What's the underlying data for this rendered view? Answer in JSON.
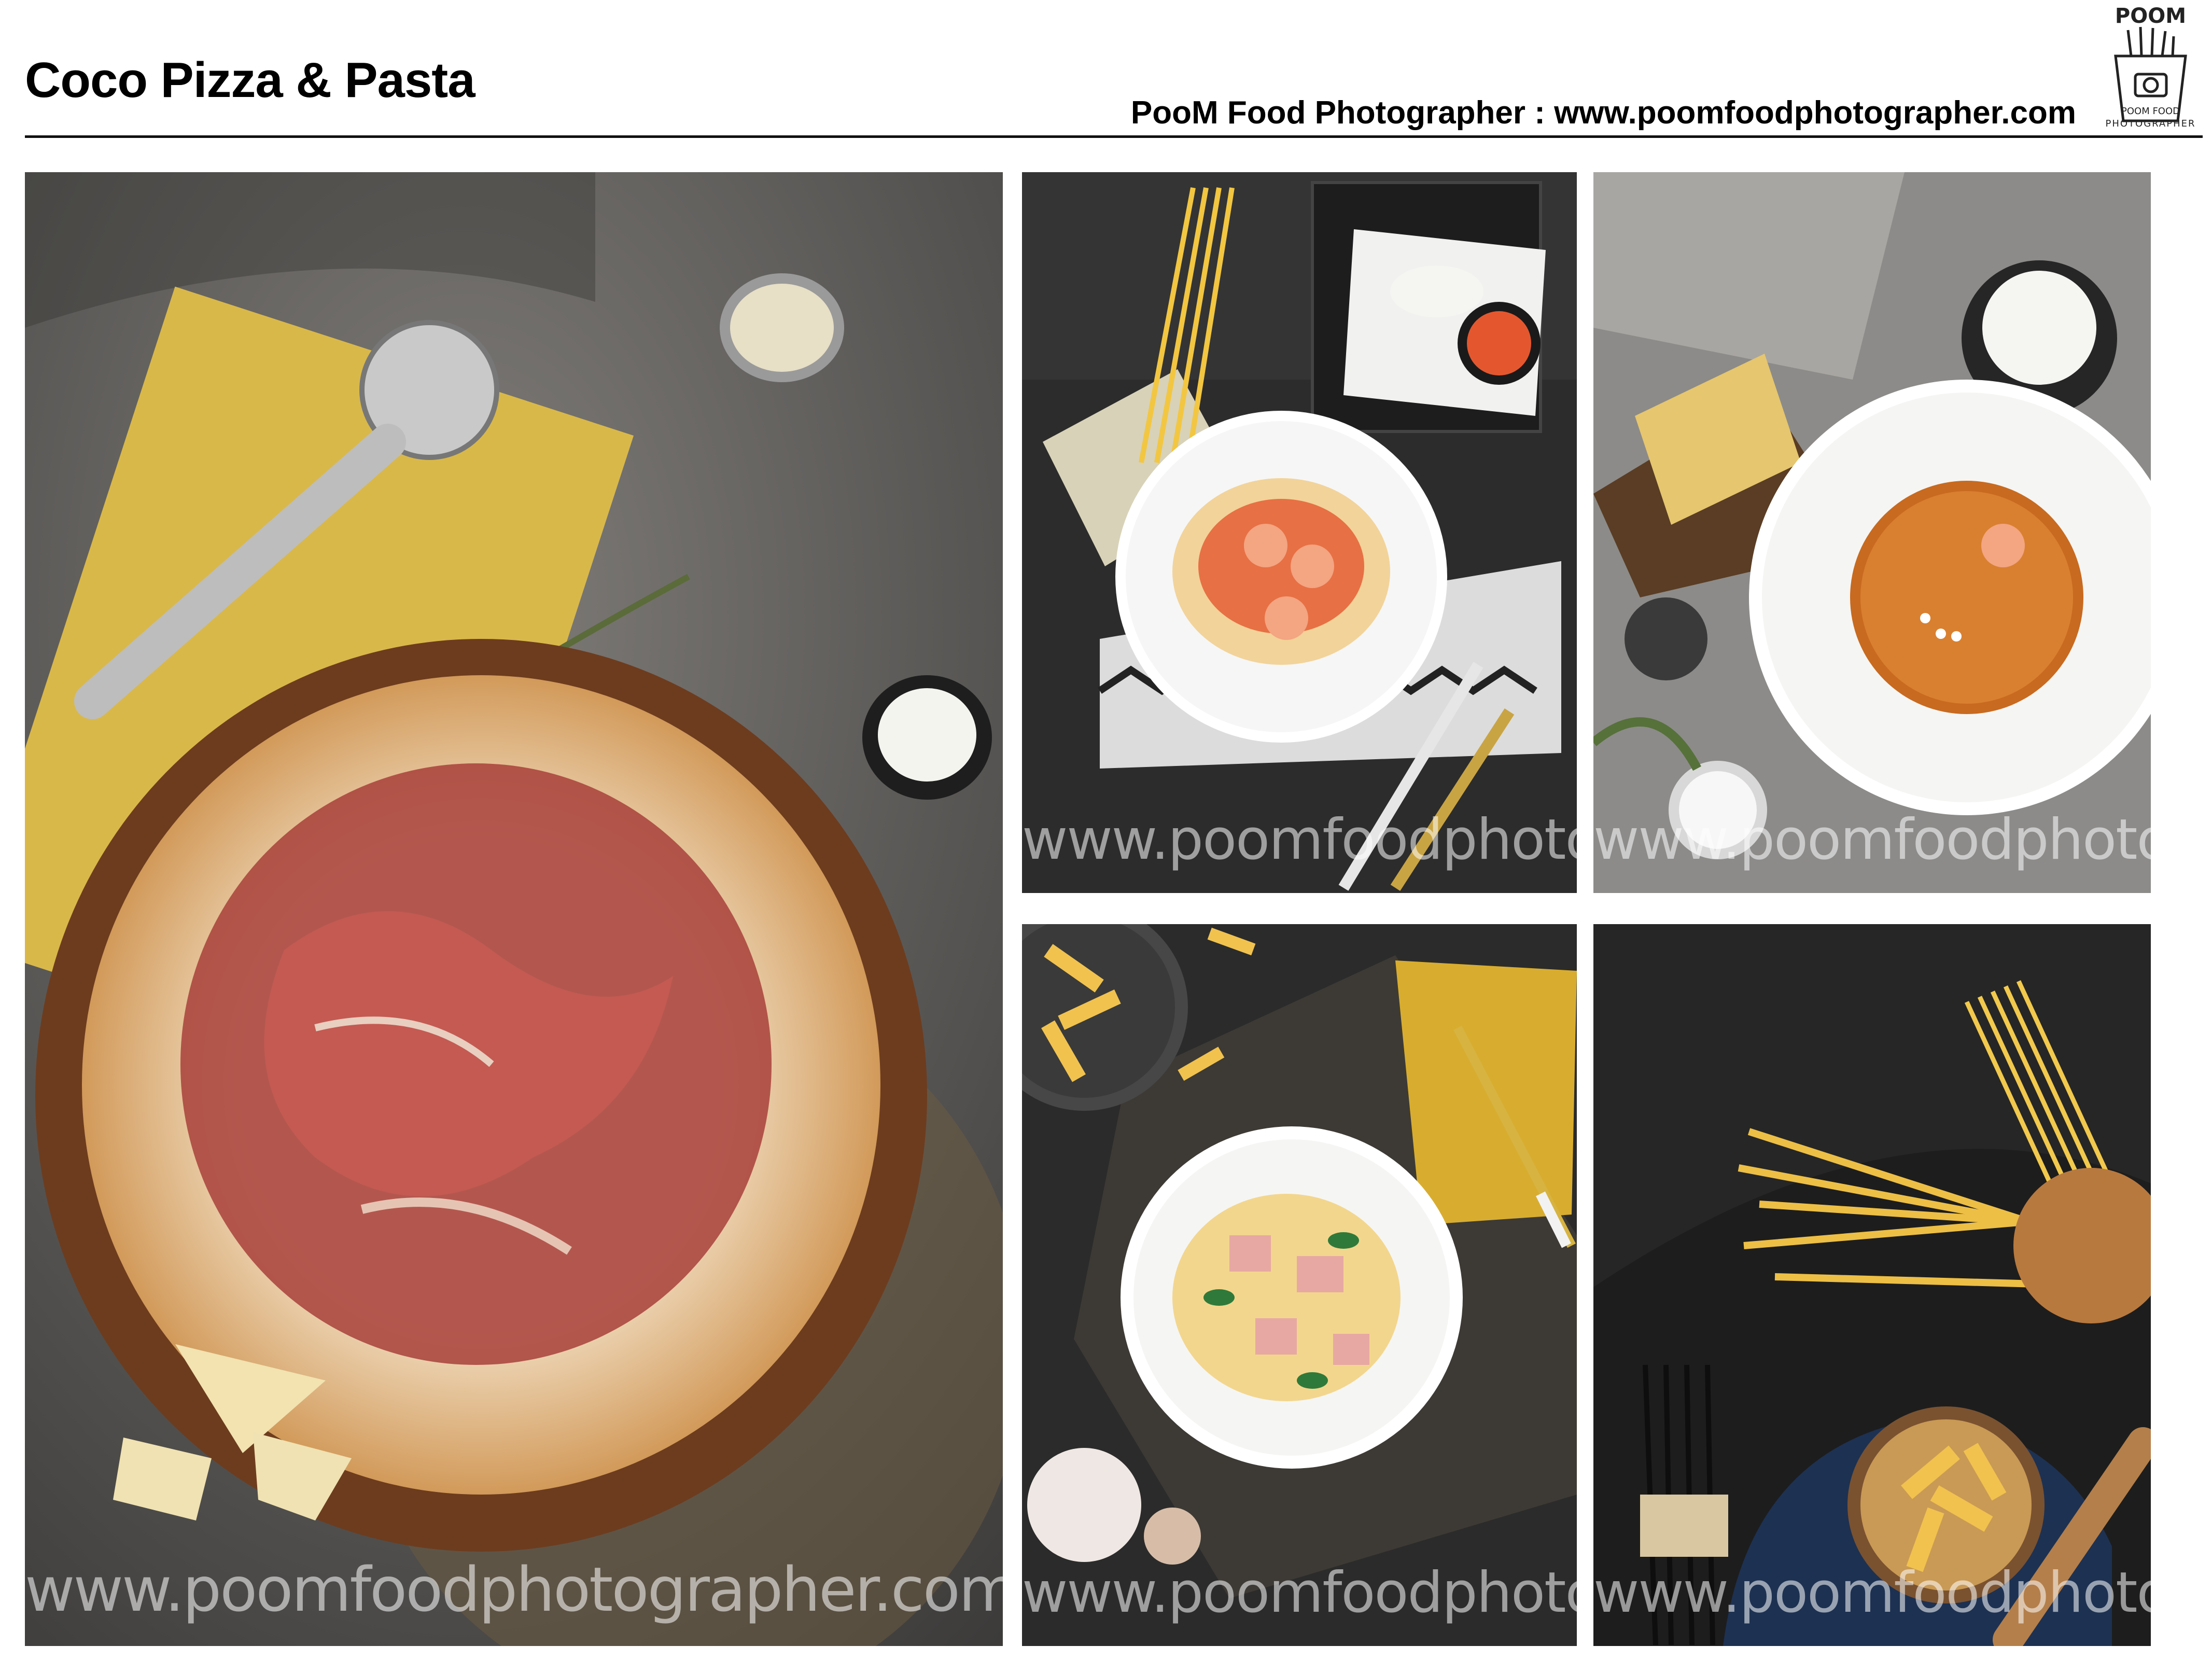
{
  "header": {
    "title": "Coco Pizza & Pasta",
    "credit": "PooM Food Photographer : www.poomfoodphotographer.com"
  },
  "logo": {
    "word": "POOM",
    "caption_line1": "POOM FOOD",
    "caption_line2": "PHOTOGRAPHER",
    "icon": "fries-box-camera-icon"
  },
  "watermark": "www.poomfoodphotographer.com",
  "photos": [
    {
      "id": "prosciutto-pizza",
      "subject": "Prosciutto pizza on wooden tray",
      "watermark_visible": true
    },
    {
      "id": "shrimp-spaghetti",
      "subject": "Shrimp spaghetti in tomato sauce",
      "watermark_visible": true
    },
    {
      "id": "lobster-bisque",
      "subject": "Bisque soup with garlic bread",
      "watermark_visible": true
    },
    {
      "id": "penne-ham",
      "subject": "Penne with ham and basil",
      "watermark_visible": true
    },
    {
      "id": "dry-pasta",
      "subject": "Dry pasta ingredients",
      "watermark_visible": true
    }
  ],
  "colors": {
    "background": "#ffffff",
    "text": "#000000",
    "rule": "#111111"
  }
}
